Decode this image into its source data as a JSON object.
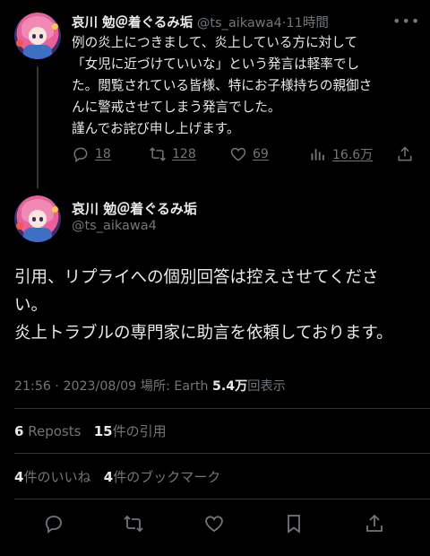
{
  "tweet1": {
    "author_name": "哀川 勉＠着ぐるみ垢",
    "handle": "@ts_aikawa4",
    "separator": "·",
    "time": "11時間",
    "body_lines": [
      "例の炎上につきまして、炎上している方に対して",
      "「女児に近づけていいな」という発言は軽率でし",
      "た。閲覧されている皆様、特にお子様持ちの親御さ",
      "んに警戒させてしまう発言でした。",
      "謹んでお詫び申し上げます。"
    ],
    "replies": "18",
    "reposts": "128",
    "likes": "69",
    "views": "16.6万",
    "icons": [
      "reply-icon",
      "repost-icon",
      "like-icon",
      "views-icon",
      "share-icon",
      "more-icon"
    ]
  },
  "tweet2": {
    "author_name": "哀川 勉＠着ぐるみ垢",
    "handle": "@ts_aikawa4",
    "body_lines": [
      "引用、リプライへの個別回答は控えさせてくださ",
      "い。",
      "炎上トラブルの専門家に助言を依頼しております。"
    ],
    "time": "21:56",
    "date": "2023/08/09",
    "location_label": "場所: Earth",
    "views_count": "5.4万",
    "views_label": "回表示",
    "reposts_count": "6",
    "reposts_label": "Reposts",
    "quotes_count": "15",
    "quotes_label": "件の引用",
    "likes_count": "4",
    "likes_label": "件のいいね",
    "bookmarks_count": "4",
    "bookmarks_label": "件のブックマーク",
    "icons": [
      "reply-icon",
      "repost-icon",
      "like-icon",
      "bookmark-icon",
      "share-icon"
    ]
  },
  "colors": {
    "background": "#000000",
    "text": "#e7e9ea",
    "muted": "#71767b",
    "divider": "#2f3336"
  }
}
